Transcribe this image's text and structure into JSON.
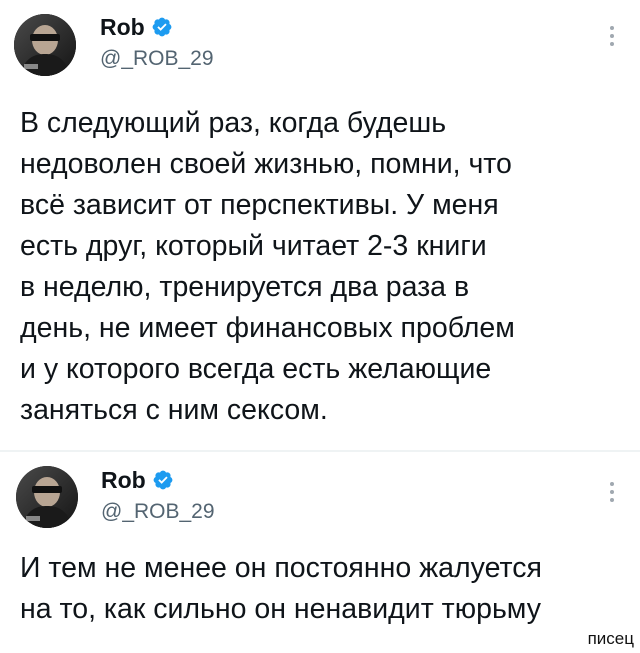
{
  "tweets": [
    {
      "author": {
        "name": "Rob",
        "handle": "@_ROB_29",
        "verified": true
      },
      "text_lines": [
        "В следующий раз, когда будешь",
        "недоволен своей жизнью, помни, что",
        "всё зависит от перспективы. У меня",
        "есть друг, который читает 2-3 книги",
        "в неделю, тренируется два раза в",
        "день, не имеет финансовых проблем",
        "и у которого всегда есть желающие",
        "заняться с ним сексом."
      ]
    },
    {
      "author": {
        "name": "Rob",
        "handle": "@_ROB_29",
        "verified": true
      },
      "text_lines": [
        "И тем не менее он постоянно жалуется",
        "на то, как сильно он ненавидит тюрьму"
      ]
    }
  ],
  "watermark": "писец",
  "colors": {
    "verified": "#1d9bf0",
    "text": "#0f1419",
    "secondary": "#536471"
  },
  "icons": {
    "verified": "verified-badge-icon",
    "more": "more-options-icon"
  }
}
